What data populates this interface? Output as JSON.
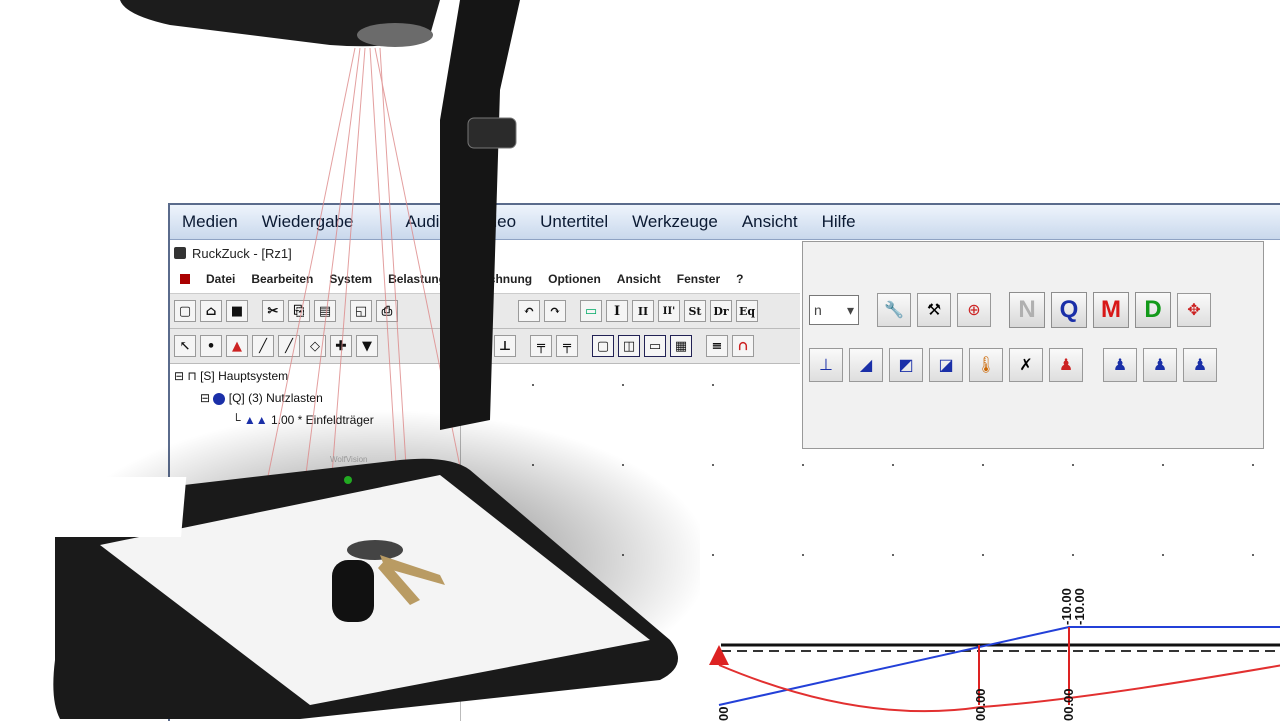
{
  "player_menu": [
    "Medien",
    "Wiedergabe",
    "Audio",
    "Video",
    "Untertitel",
    "Werkzeuge",
    "Ansicht",
    "Hilfe"
  ],
  "rz_window_title": "RuckZuck - [Rz1]",
  "rz_menu": [
    "Datei",
    "Bearbeiten",
    "System",
    "Belastung",
    "Berechnung",
    "Optionen",
    "Ansicht",
    "Fenster",
    "?"
  ],
  "rz_toolbar1": [
    "I",
    "II",
    "II'",
    "St",
    "Dr",
    "Eq"
  ],
  "rz_toolbar_big": {
    "dropdown_value": "n",
    "letters": [
      {
        "label": "N",
        "color": "#b0b0b0"
      },
      {
        "label": "Q",
        "color": "#1a2fa8"
      },
      {
        "label": "M",
        "color": "#d81818"
      },
      {
        "label": "D",
        "color": "#139a1a"
      }
    ]
  },
  "tree": {
    "root": "[S] Hauptsystem",
    "child": "[Q] (3) Nutzlasten",
    "leaf": "1.00 * Einfeldträger"
  },
  "beam_labels": [
    "-10.00",
    "-10.00"
  ],
  "bottom_labels": [
    "00",
    "00.00",
    "00.00"
  ],
  "visualizer_brand": "WolfVision"
}
